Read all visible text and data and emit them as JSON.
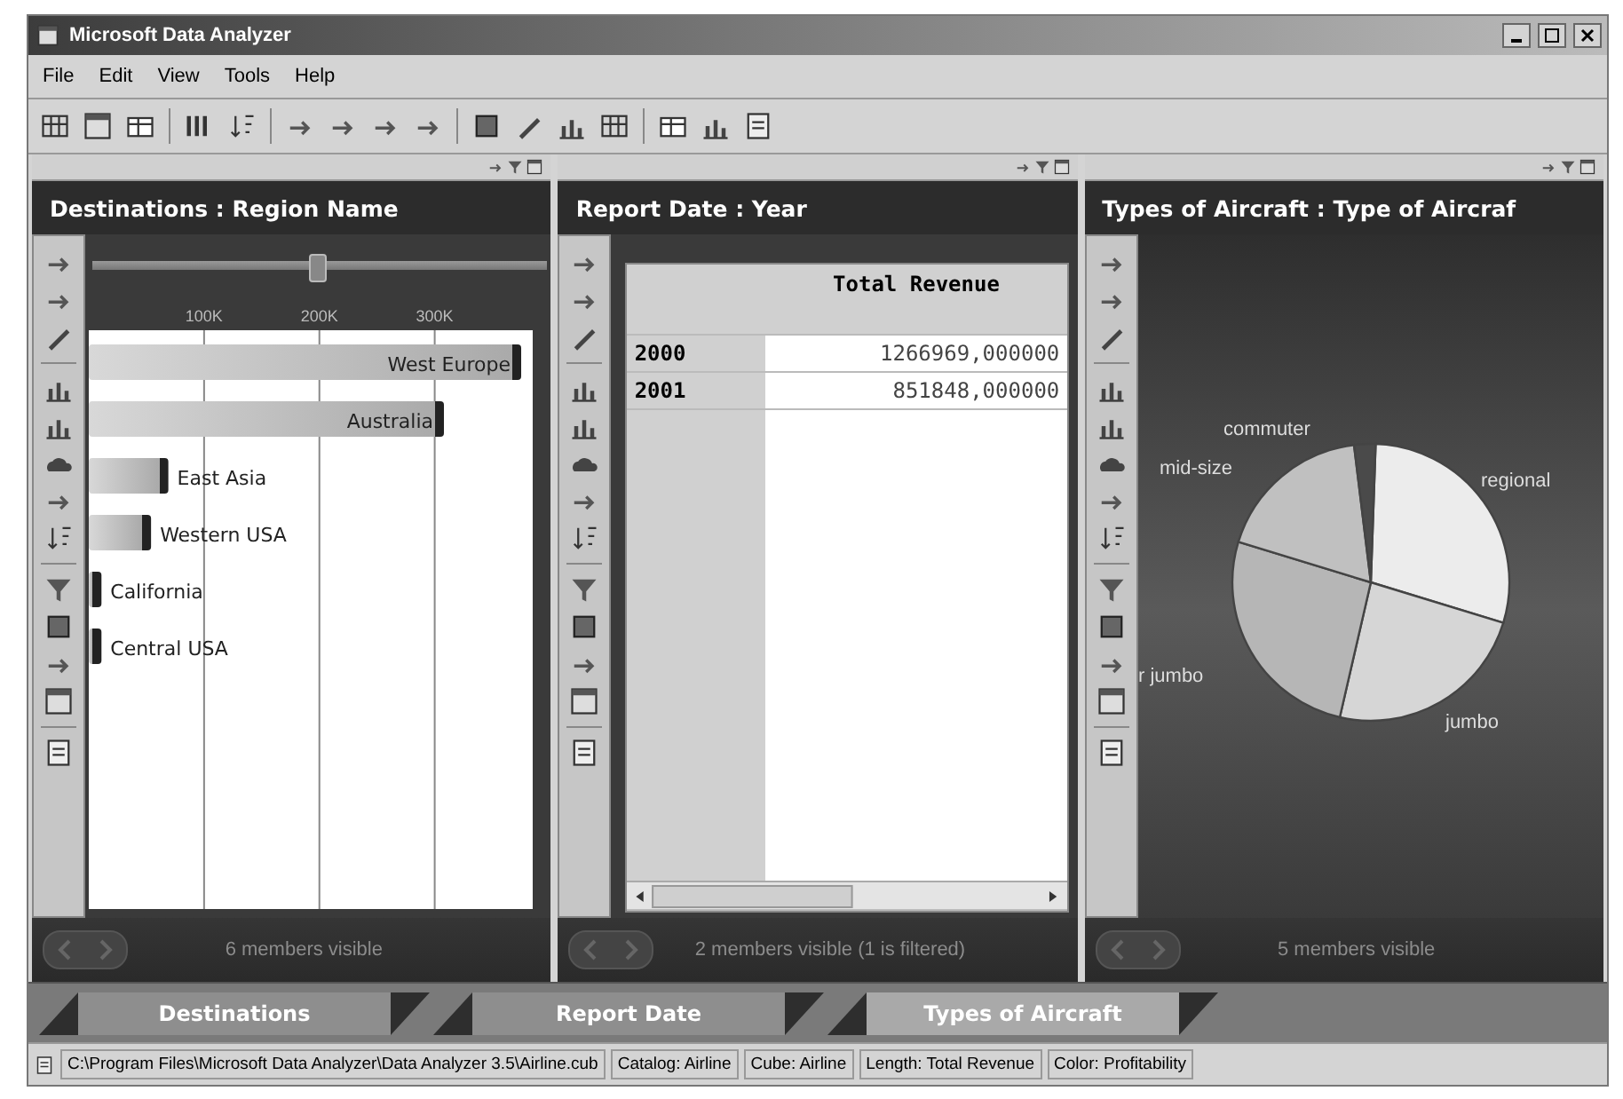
{
  "window": {
    "title": "Microsoft Data Analyzer"
  },
  "menu": [
    "File",
    "Edit",
    "View",
    "Tools",
    "Help"
  ],
  "panels": [
    {
      "kind": "bar",
      "title": "Destinations : Region Name",
      "zoom_slider": {
        "level": 0.49
      },
      "chart_data": {
        "type": "bar",
        "orientation": "horizontal",
        "categories": [
          "West Europe",
          "Australia",
          "East Asia",
          "Western USA",
          "California",
          "Central USA"
        ],
        "values": [
          375000,
          308000,
          69000,
          54000,
          11000,
          11000
        ],
        "xlim": [
          0,
          385000
        ],
        "grid": true,
        "xticks": [
          {
            "value": 100000,
            "label": "100K"
          },
          {
            "value": 200000,
            "label": "200K"
          },
          {
            "value": 300000,
            "label": "300K"
          }
        ]
      },
      "footer": "6 members visible"
    },
    {
      "kind": "grid",
      "title": "Report Date : Year",
      "column": "Total Revenue",
      "rows": [
        {
          "label": "2000",
          "value": "1266969,000000"
        },
        {
          "label": "2001",
          "value": "851848,000000"
        }
      ],
      "footer": "2 members visible (1 is filtered)"
    },
    {
      "kind": "pie",
      "title": "Types of Aircraft : Type of Aircraf",
      "slice_labels": [
        "regional",
        "jumbo",
        "r jumbo",
        "mid-size",
        "commuter"
      ],
      "footer": "5 members visible"
    }
  ],
  "tabs": [
    {
      "label": "Destinations",
      "selected": false
    },
    {
      "label": "Report Date",
      "selected": false
    },
    {
      "label": "Types of Aircraft",
      "selected": true
    }
  ],
  "status_bar": [
    "C:\\Program Files\\Microsoft Data Analyzer\\Data Analyzer 3.5\\Airline.cub",
    "Catalog: Airline",
    "Cube: Airline",
    "Length: Total Revenue",
    "Color: Profitability"
  ]
}
